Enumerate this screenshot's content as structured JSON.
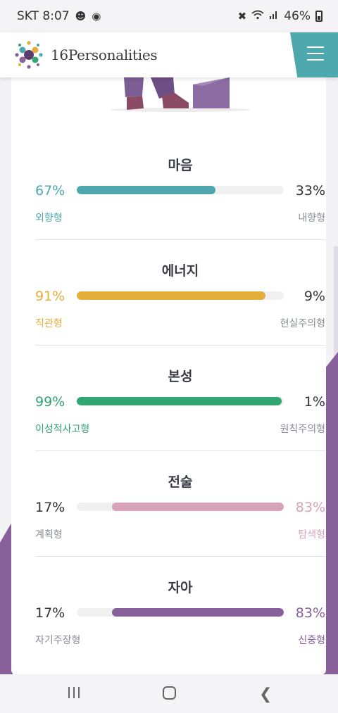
{
  "status_bar": {
    "carrier_time": "SKT 8:07",
    "battery": "46%",
    "icons": [
      "notification-icon",
      "music-icon",
      "mute-icon",
      "wifi-icon",
      "signal-icon",
      "battery-icon"
    ]
  },
  "header": {
    "logo_text": "16Personalities",
    "menu_icon": "hamburger-icon",
    "accent_color": "#4fa8ad"
  },
  "traits": [
    {
      "title": "마음",
      "left_pct": "67%",
      "right_pct": "33%",
      "left_label": "외향형",
      "right_label": "내향형",
      "fill_fraction": 0.67,
      "fill_side": "left",
      "color": "#4ea8ad",
      "highlight": "left"
    },
    {
      "title": "에너지",
      "left_pct": "91%",
      "right_pct": "9%",
      "left_label": "직관형",
      "right_label": "현실주의형",
      "fill_fraction": 0.91,
      "fill_side": "left",
      "color": "#e4ae3a",
      "highlight": "left"
    },
    {
      "title": "본성",
      "left_pct": "99%",
      "right_pct": "1%",
      "left_label": "이성적사고형",
      "right_label": "원칙주의형",
      "fill_fraction": 0.99,
      "fill_side": "left",
      "color": "#33a474",
      "highlight": "left"
    },
    {
      "title": "전술",
      "left_pct": "17%",
      "right_pct": "83%",
      "left_label": "계획형",
      "right_label": "탐색형",
      "fill_fraction": 0.83,
      "fill_side": "right",
      "color": "#d6a3b8",
      "highlight": "right"
    },
    {
      "title": "자아",
      "left_pct": "17%",
      "right_pct": "83%",
      "left_label": "자기주장형",
      "right_label": "신중형",
      "fill_fraction": 0.83,
      "fill_side": "right",
      "color": "#88619a",
      "highlight": "right"
    }
  ],
  "nav_bar": {
    "icons": [
      "recent-apps-icon",
      "home-icon",
      "back-icon"
    ]
  }
}
